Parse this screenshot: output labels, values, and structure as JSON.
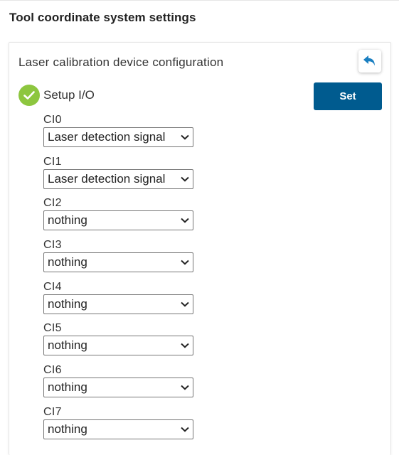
{
  "page": {
    "title": "Tool coordinate system settings"
  },
  "panel": {
    "title": "Laser calibration device configuration",
    "back_icon": "undo-arrow-icon",
    "setup": {
      "status_icon": "check-circle-icon",
      "status_color": "#8dc63f",
      "label": "Setup I/O"
    },
    "set_button": {
      "label": "Set",
      "color": "#005b8f"
    },
    "io_inputs": [
      {
        "label": "CI0",
        "value": "Laser detection signal"
      },
      {
        "label": "CI1",
        "value": "Laser detection signal"
      },
      {
        "label": "CI2",
        "value": "nothing"
      },
      {
        "label": "CI3",
        "value": "nothing"
      },
      {
        "label": "CI4",
        "value": "nothing"
      },
      {
        "label": "CI5",
        "value": "nothing"
      },
      {
        "label": "CI6",
        "value": "nothing"
      },
      {
        "label": "CI7",
        "value": "nothing"
      }
    ]
  }
}
